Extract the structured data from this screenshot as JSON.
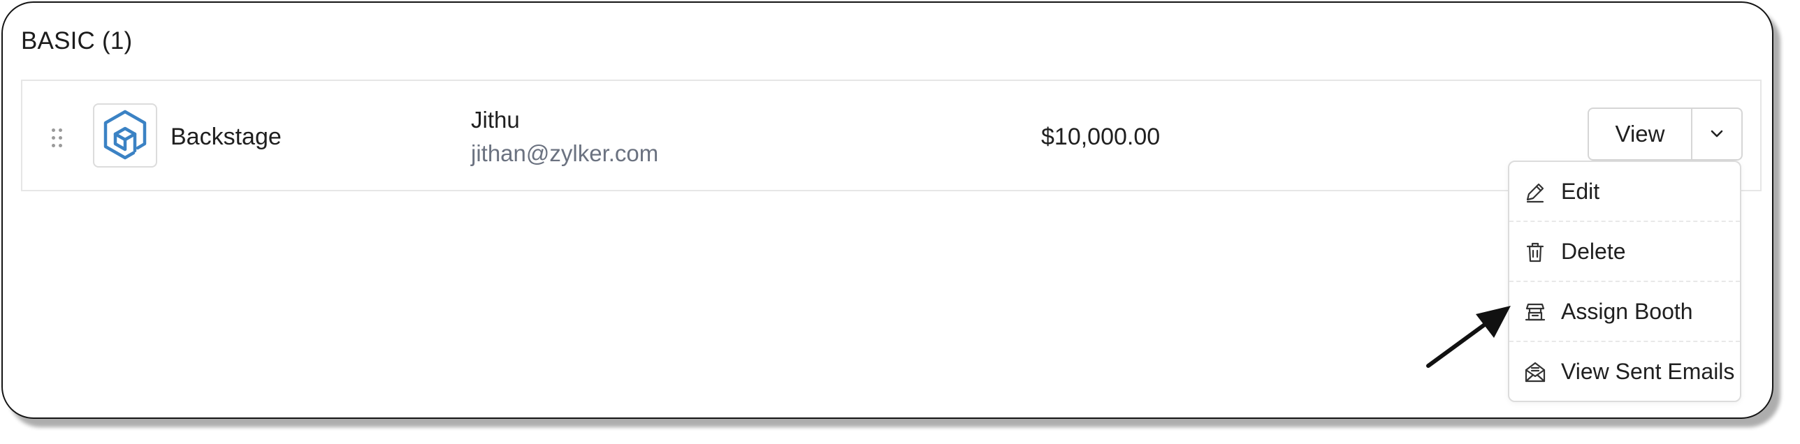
{
  "section": {
    "title": "BASIC (1)"
  },
  "row": {
    "sponsor_name": "Backstage",
    "contact_name": "Jithu",
    "contact_email": "jithan@zylker.com",
    "amount": "$10,000.00",
    "view_label": "View",
    "logo_icon": "cube-logo-icon",
    "logo_color": "#3b82c4"
  },
  "menu": {
    "items": [
      {
        "label": "Edit",
        "icon": "pencil-icon"
      },
      {
        "label": "Delete",
        "icon": "trash-icon"
      },
      {
        "label": "Assign Booth",
        "icon": "booth-icon"
      },
      {
        "label": "View Sent Emails",
        "icon": "mail-open-icon"
      }
    ]
  }
}
